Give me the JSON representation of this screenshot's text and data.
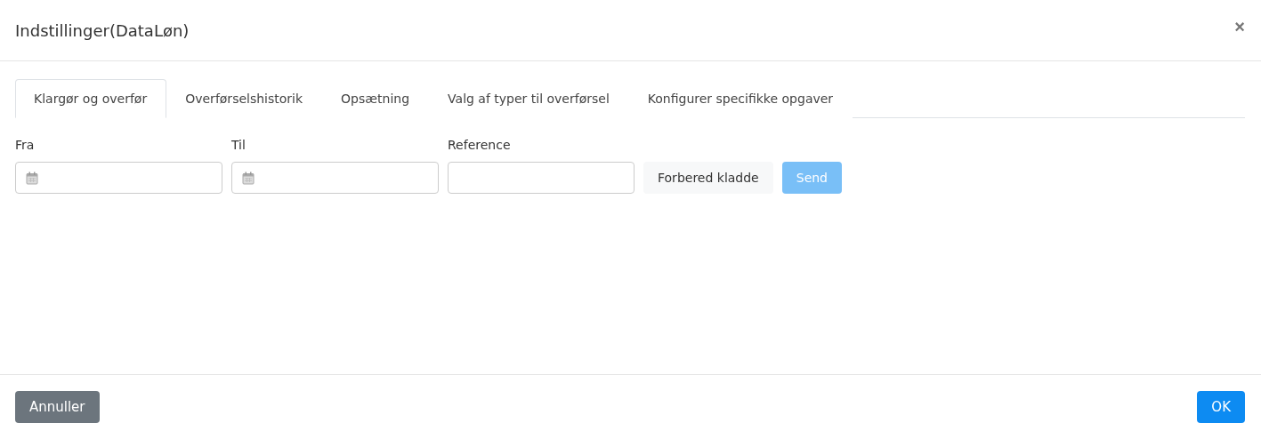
{
  "dialog": {
    "title": "Indstillinger(DataLøn)",
    "close": "×"
  },
  "tabs": [
    {
      "label": "Klargør og overfør",
      "selected": true
    },
    {
      "label": "Overførselshistorik",
      "selected": false
    },
    {
      "label": "Opsætning",
      "selected": false
    },
    {
      "label": "Valg af typer til overførsel",
      "selected": false
    },
    {
      "label": "Konfigurer specifikke opgaver",
      "selected": false
    }
  ],
  "fields": [
    {
      "label": "Fra",
      "kind": "date"
    },
    {
      "label": "Til",
      "kind": "date"
    },
    {
      "label": "Reference",
      "kind": "text"
    }
  ],
  "actions": [
    {
      "label": "Forbered kladde",
      "kind": "light",
      "disabled": false
    },
    {
      "label": "Send",
      "kind": "primary",
      "disabled": true
    }
  ],
  "footer": {
    "cancel": "Annuller",
    "ok": "OK"
  }
}
